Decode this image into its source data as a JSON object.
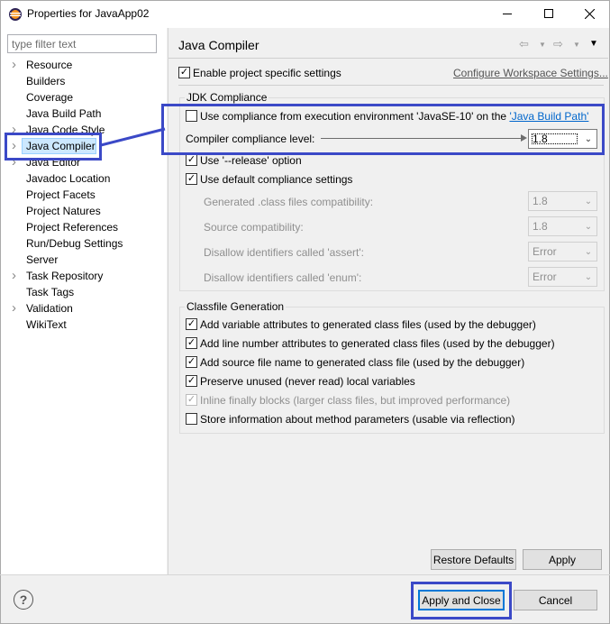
{
  "window": {
    "title": "Properties for JavaApp02",
    "icons": {
      "app": "eclipse-icon",
      "minimize": "minimize-icon",
      "maximize": "maximize-icon",
      "close": "close-icon"
    }
  },
  "sidebar": {
    "filter_placeholder": "type filter text",
    "items": [
      {
        "label": "Resource",
        "expandable": true
      },
      {
        "label": "Builders",
        "expandable": false
      },
      {
        "label": "Coverage",
        "expandable": false
      },
      {
        "label": "Java Build Path",
        "expandable": false
      },
      {
        "label": "Java Code Style",
        "expandable": true
      },
      {
        "label": "Java Compiler",
        "expandable": true,
        "selected": true
      },
      {
        "label": "Java Editor",
        "expandable": true
      },
      {
        "label": "Javadoc Location",
        "expandable": false
      },
      {
        "label": "Project Facets",
        "expandable": false
      },
      {
        "label": "Project Natures",
        "expandable": false
      },
      {
        "label": "Project References",
        "expandable": false
      },
      {
        "label": "Run/Debug Settings",
        "expandable": false
      },
      {
        "label": "Server",
        "expandable": false
      },
      {
        "label": "Task Repository",
        "expandable": true
      },
      {
        "label": "Task Tags",
        "expandable": false
      },
      {
        "label": "Validation",
        "expandable": true
      },
      {
        "label": "WikiText",
        "expandable": false
      }
    ]
  },
  "main": {
    "title": "Java Compiler",
    "enable_project_settings": {
      "label": "Enable project specific settings",
      "checked": true
    },
    "configure_workspace_link": "Configure Workspace Settings...",
    "jdk_compliance": {
      "group_title": "JDK Compliance",
      "use_env_compliance": {
        "label": "Use compliance from execution environment 'JavaSE-10' on the ",
        "link": "'Java Build Path'",
        "checked": false
      },
      "compliance_level": {
        "label": "Compiler compliance level:",
        "value": "1.8"
      },
      "use_release": {
        "label": "Use '--release' option",
        "checked": true
      },
      "use_default": {
        "label": "Use default compliance settings",
        "checked": true
      },
      "generated_class": {
        "label": "Generated .class files compatibility:",
        "value": "1.8"
      },
      "source_compat": {
        "label": "Source compatibility:",
        "value": "1.8"
      },
      "disallow_assert": {
        "label": "Disallow identifiers called 'assert':",
        "value": "Error"
      },
      "disallow_enum": {
        "label": "Disallow identifiers called 'enum':",
        "value": "Error"
      }
    },
    "classfile": {
      "group_title": "Classfile Generation",
      "options": [
        {
          "label": "Add variable attributes to generated class files (used by the debugger)",
          "checked": true,
          "disabled": false
        },
        {
          "label": "Add line number attributes to generated class files (used by the debugger)",
          "checked": true,
          "disabled": false
        },
        {
          "label": "Add source file name to generated class file (used by the debugger)",
          "checked": true,
          "disabled": false
        },
        {
          "label": "Preserve unused (never read) local variables",
          "checked": true,
          "disabled": false
        },
        {
          "label": "Inline finally blocks (larger class files, but improved performance)",
          "checked": true,
          "disabled": true
        },
        {
          "label": "Store information about method parameters (usable via reflection)",
          "checked": false,
          "disabled": false
        }
      ]
    },
    "restore_defaults": "Restore Defaults",
    "apply": "Apply"
  },
  "footer": {
    "help_icon": "help-icon",
    "apply_and_close": "Apply and Close",
    "cancel": "Cancel"
  },
  "colors": {
    "callout": "#3b49c7",
    "selection": "#cce8ff",
    "link": "#0066cc"
  }
}
